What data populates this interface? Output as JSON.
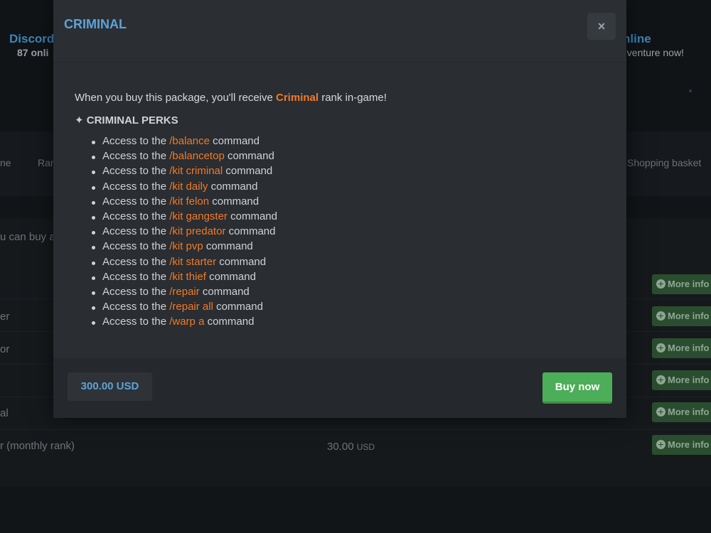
{
  "background": {
    "discord": {
      "title": "Discord",
      "subtitle": "87 onli"
    },
    "online": {
      "title": "nline",
      "subtitle": "dventure now!"
    },
    "nav": [
      "ne",
      "Ran",
      "Shopping basket"
    ],
    "intro_text": "u can buy a",
    "rows": [
      "er",
      "or",
      "al",
      "r (monthly rank)"
    ],
    "row_price": {
      "amount": "30.00",
      "currency": "USD"
    },
    "more_info_label": "More info"
  },
  "modal": {
    "title": "CRIMINAL",
    "close_label": "×",
    "intro": {
      "before": "When you buy this package, you'll receive ",
      "rank": "Criminal",
      "after": " rank in-game!"
    },
    "perks_heading": "✦ CRIMINAL PERKS",
    "perk_prefix": "Access to the ",
    "perk_suffix": " command",
    "perks": [
      "/balance",
      "/balancetop",
      "/kit criminal",
      "/kit daily",
      "/kit felon",
      "/kit gangster",
      "/kit predator",
      "/kit pvp",
      "/kit starter",
      "/kit thief",
      "/repair",
      "/repair all",
      "/warp a"
    ],
    "price": "300.00 USD",
    "buy_label": "Buy now"
  },
  "colors": {
    "accent_blue": "#5da3d8",
    "accent_orange": "#f07a28",
    "buy_green": "#4cae58"
  }
}
